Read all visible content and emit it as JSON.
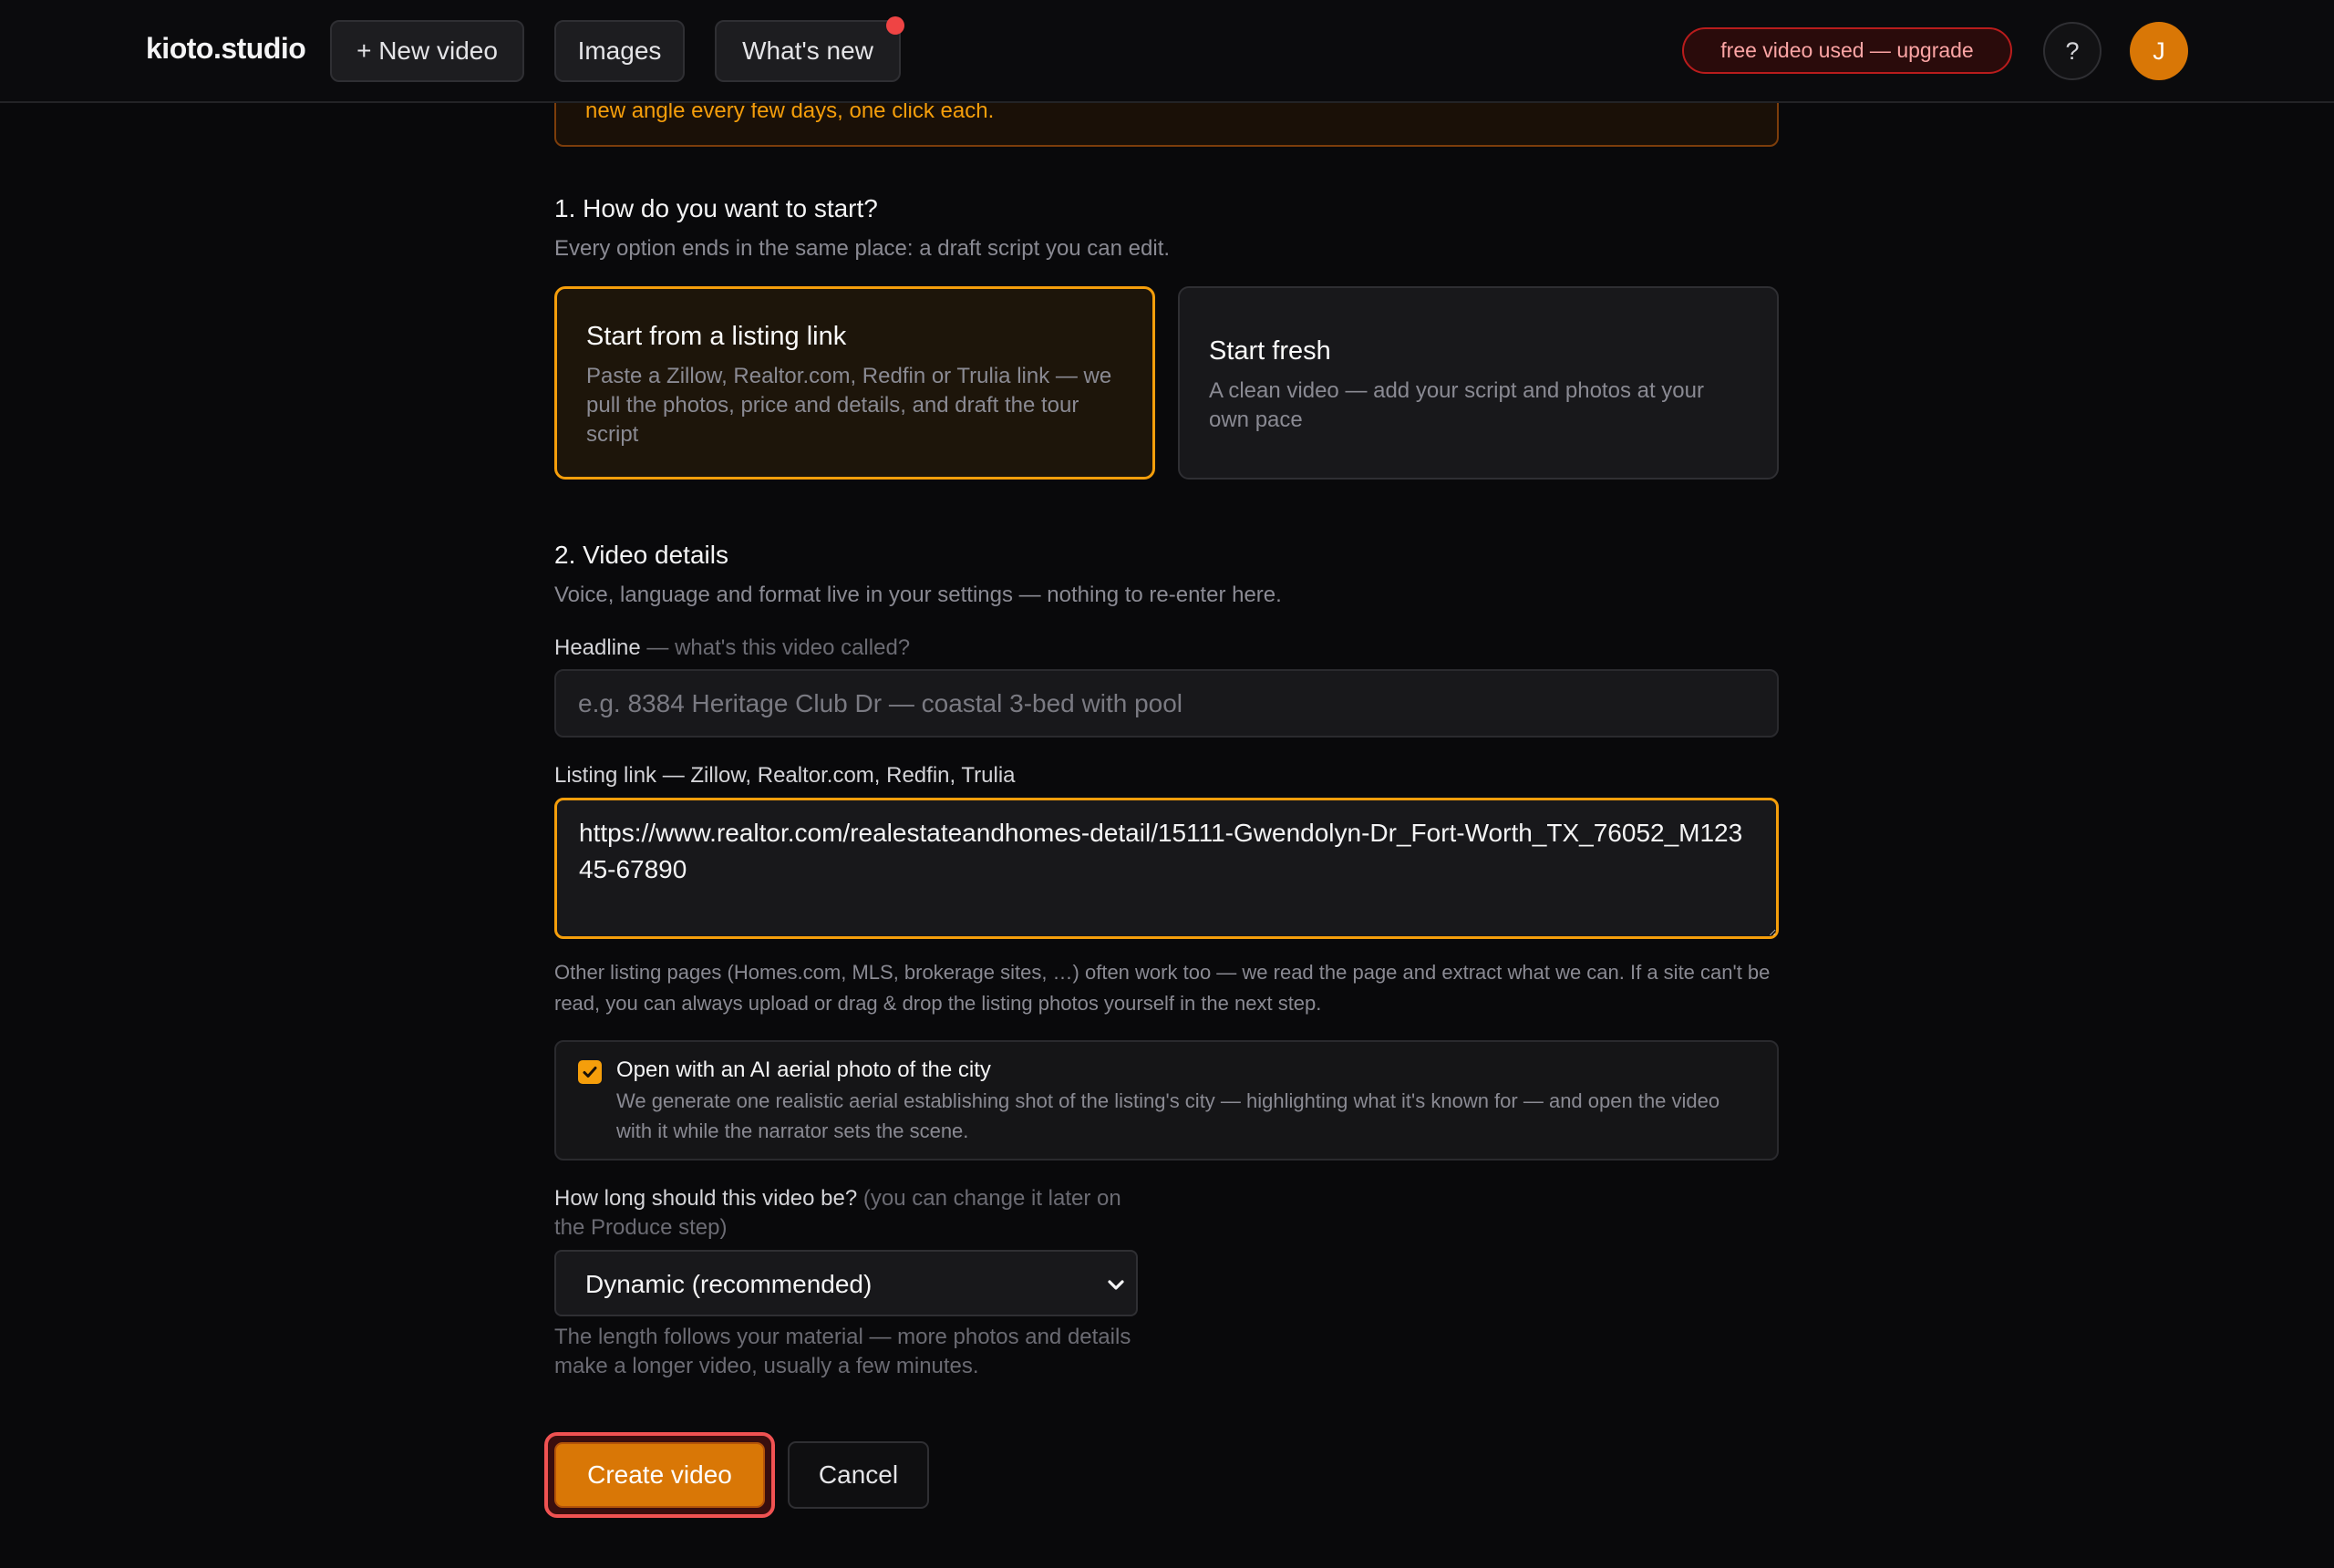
{
  "topbar": {
    "brand": "kioto.studio",
    "new_video": "+ New video",
    "images": "Images",
    "whats_new": "What's new",
    "upgrade": "free video used — upgrade",
    "help": "?",
    "avatar_initial": "J"
  },
  "banner": {
    "text": "new angle every few days, one click each."
  },
  "step1": {
    "title": "1. How do you want to start?",
    "subtitle": "Every option ends in the same place: a draft script you can edit.",
    "options": [
      {
        "title": "Start from a listing link",
        "desc": "Paste a Zillow, Realtor.com, Redfin or Trulia link — we pull the photos, price and details, and draft the tour script",
        "selected": true
      },
      {
        "title": "Start fresh",
        "desc": "A clean video — add your script and photos at your own pace",
        "selected": false
      }
    ]
  },
  "step2": {
    "title": "2. Video details",
    "subtitle": "Voice, language and format live in your settings — nothing to re-enter here.",
    "headline_label": "Headline",
    "headline_hint": "— what's this video called?",
    "headline_placeholder": "e.g. 8384 Heritage Club Dr — coastal 3-bed with pool",
    "headline_value": "",
    "link_label": "Listing link — Zillow, Realtor.com, Redfin, Trulia",
    "link_value": "https://www.realtor.com/realestateandhomes-detail/15111-Gwendolyn-Dr_Fort-Worth_TX_76052_M12345-67890",
    "link_help": "Other listing pages (Homes.com, MLS, brokerage sites, …) often work too — we read the page and extract what we can. If a site can't be read, you can always upload or drag & drop the listing photos yourself in the next step.",
    "aerial": {
      "checked": true,
      "title": "Open with an AI aerial photo of the city",
      "desc": "We generate one realistic aerial establishing shot of the listing's city — highlighting what it's known for — and open the video with it while the narrator sets the scene."
    },
    "length_label": "How long should this video be?",
    "length_hint": "(you can change it later on the Produce step)",
    "length_value": "Dynamic (recommended)",
    "length_help": "The length follows your material — more photos and details make a longer video, usually a few minutes."
  },
  "actions": {
    "create": "Create video",
    "cancel": "Cancel"
  },
  "colors": {
    "accent": "#f59e0b",
    "primary_button": "#d97706",
    "alert_red": "#ef4444",
    "background": "#09090b"
  }
}
